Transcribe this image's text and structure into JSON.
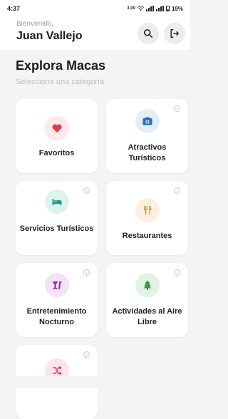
{
  "status_bar": {
    "time": "4:37",
    "speed": "3,00",
    "battery": "19%"
  },
  "header": {
    "greeting": "Bienvenido,",
    "user_name": "Juan Vallejo",
    "search_icon": "search-icon",
    "logout_icon": "logout-icon"
  },
  "main": {
    "title": "Explora Macas",
    "subtitle": "Selecciona una categoría"
  },
  "categories": [
    {
      "label": "Favoritos",
      "icon": "heart-icon",
      "icon_color": "#e53946",
      "bg": "#fde9ea",
      "has_info": false
    },
    {
      "label": "Atractivos Turísticos",
      "icon": "camera-icon",
      "icon_color": "#1e74c8",
      "bg": "#e3eefb",
      "has_info": true
    },
    {
      "label": "Servicios Turísticos",
      "icon": "bed-icon",
      "icon_color": "#149c8b",
      "bg": "#ddf3ef",
      "has_info": true
    },
    {
      "label": "Restaurantes",
      "icon": "restaurant-icon",
      "icon_color": "#f08a1c",
      "bg": "#fdf0df",
      "has_info": true
    },
    {
      "label": "Entretenimiento Nocturno",
      "icon": "cocktail-icon",
      "icon_color": "#8e2eb0",
      "bg": "#f2e3f7",
      "has_info": true
    },
    {
      "label": "Actividades al Aire Libre",
      "icon": "tree-icon",
      "icon_color": "#2e9d48",
      "bg": "#e2f3e6",
      "has_info": true
    },
    {
      "label": "",
      "icon": "shuffle-icon",
      "icon_color": "#e2336b",
      "bg": "#fde4ec",
      "has_info": true
    }
  ]
}
